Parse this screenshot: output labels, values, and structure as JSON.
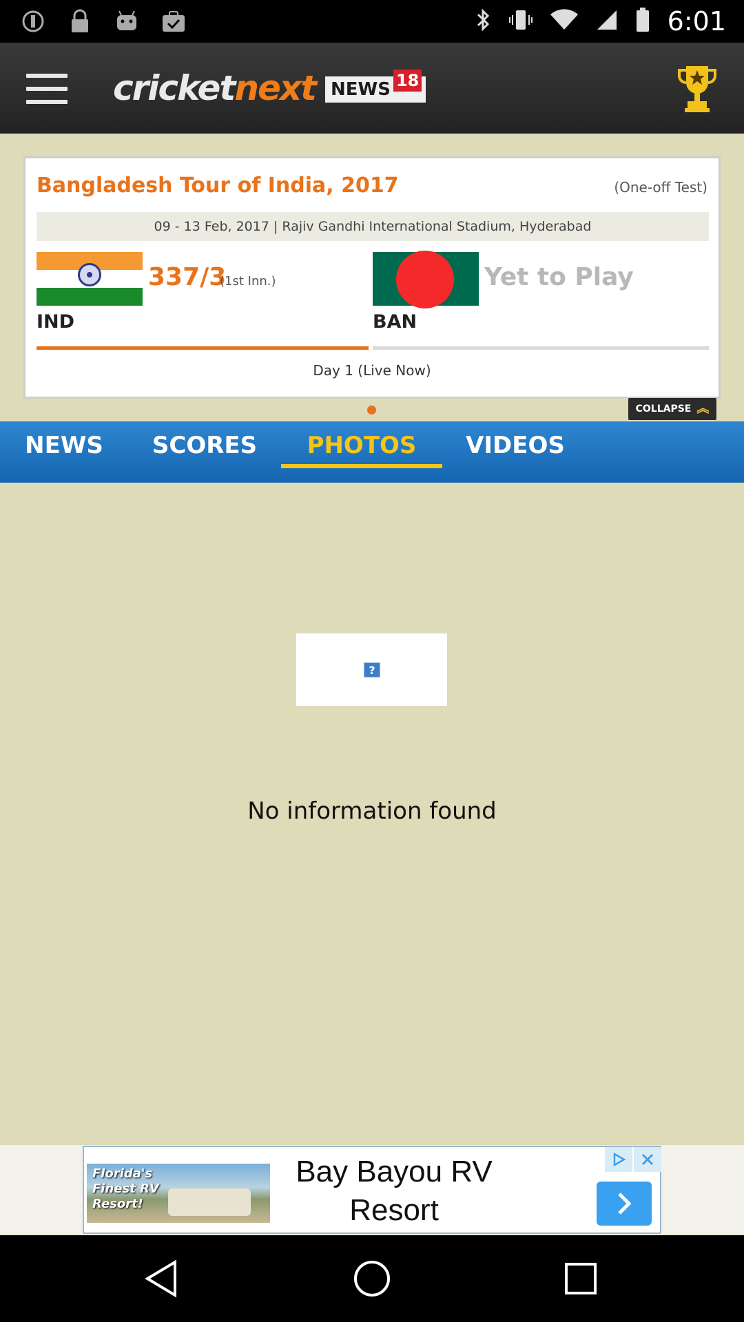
{
  "status_bar": {
    "time": "6:01",
    "left_icons": [
      "info-icon",
      "lock-icon",
      "android-icon",
      "clipboard-check-icon"
    ],
    "right_icons": [
      "bluetooth-icon",
      "vibrate-icon",
      "wifi-icon",
      "signal-icon",
      "battery-icon"
    ]
  },
  "header": {
    "logo_cricket": "cricket",
    "logo_next": "next",
    "logo_news": "NEWS",
    "logo_18": "18",
    "menu_icon": "hamburger-menu-icon",
    "trophy_icon": "trophy-icon"
  },
  "match": {
    "title": "Bangladesh Tour of India, 2017",
    "type": "(One-off Test)",
    "venue": "09 - 13 Feb, 2017 | Rajiv Gandhi International Stadium, Hyderabad",
    "team1": {
      "code": "IND",
      "score": "337/3",
      "innings": "(1st Inn.)"
    },
    "team2": {
      "code": "BAN",
      "status": "Yet to Play"
    },
    "day_status": "Day 1 (Live Now)",
    "collapse_label": "COLLAPSE"
  },
  "tabs": {
    "items": [
      {
        "label": "NEWS"
      },
      {
        "label": "SCORES"
      },
      {
        "label": "PHOTOS"
      },
      {
        "label": "VIDEOS"
      }
    ],
    "active": "PHOTOS"
  },
  "content": {
    "empty_message": "No information found",
    "broken_image_glyph": "?"
  },
  "ad": {
    "headline": "Bay Bayou RV Resort",
    "image_caption": "Florida's Finest RV Resort!",
    "colors": {
      "arrow_bg": "#3aa0f0"
    }
  },
  "colors": {
    "accent": "#e8731c",
    "tab_bar": "#1f77c4",
    "active_tab": "#f5c518",
    "background": "#dedbb8"
  }
}
